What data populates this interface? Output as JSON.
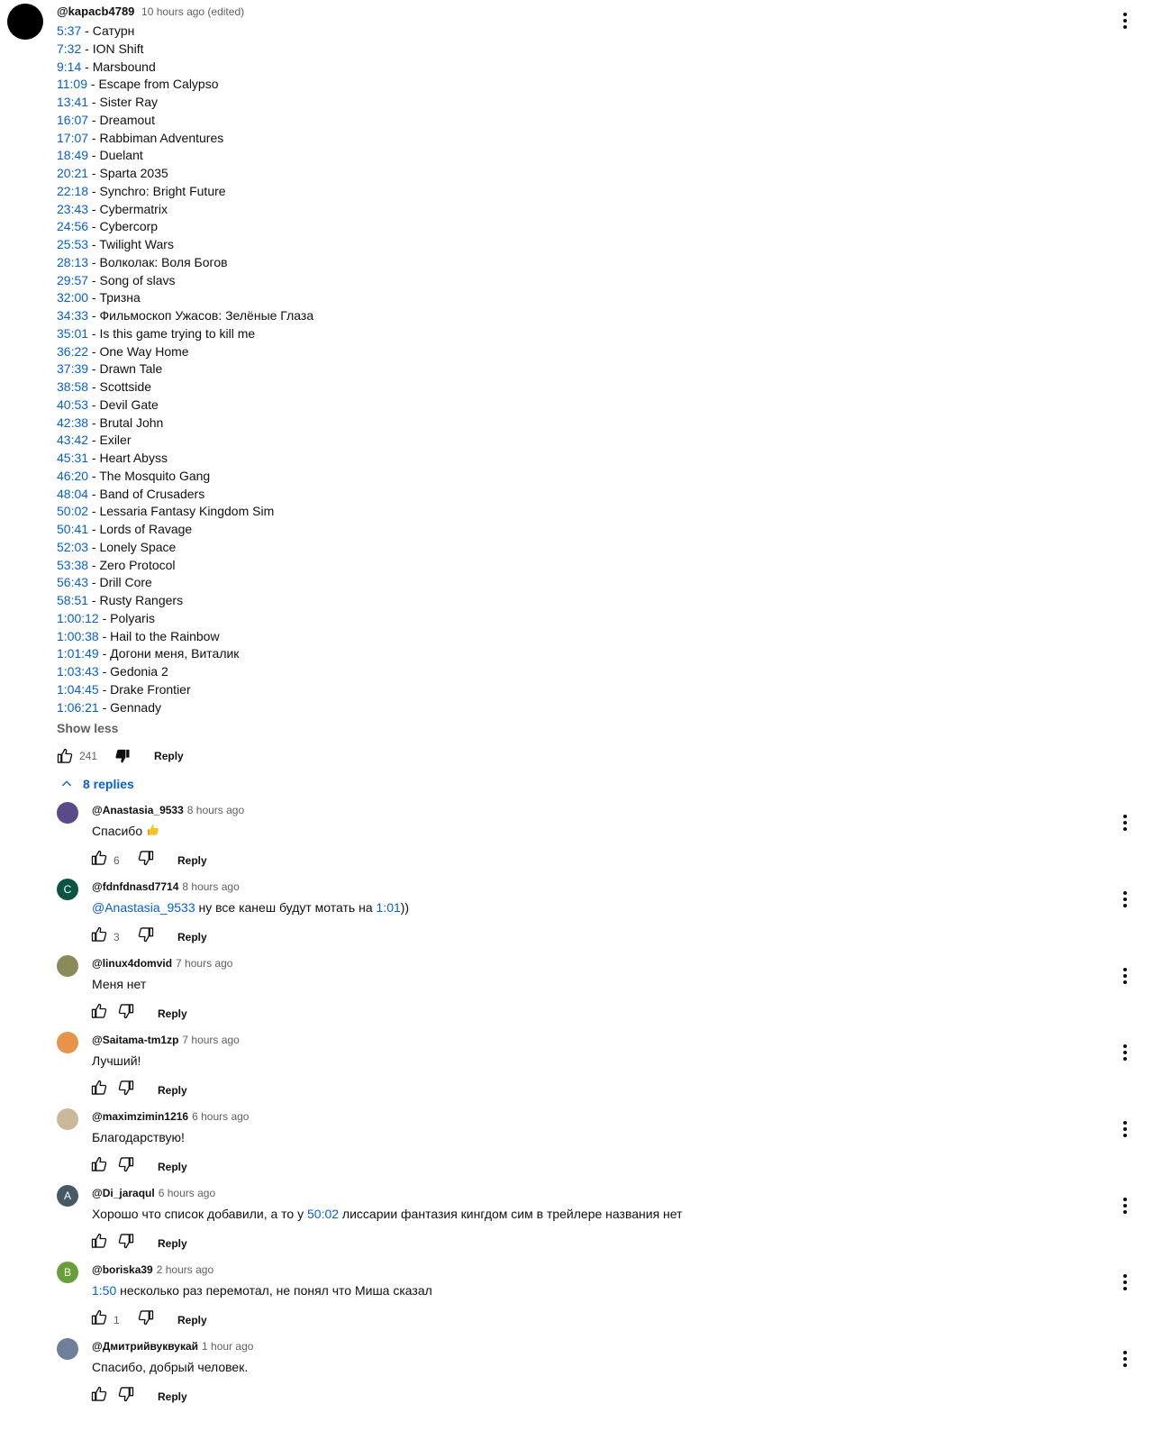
{
  "comment": {
    "handle": "@kapacb4789",
    "time": "10 hours ago (edited)",
    "chapters": [
      {
        "ts": "5:37",
        "title": " - Сатурн"
      },
      {
        "ts": "7:32",
        "title": " - ION Shift"
      },
      {
        "ts": "9:14",
        "title": " - Marsbound"
      },
      {
        "ts": "11:09",
        "title": " - Escape from Calypso"
      },
      {
        "ts": "13:41",
        "title": " - Sister Ray"
      },
      {
        "ts": "16:07",
        "title": " - Dreamout"
      },
      {
        "ts": "17:07",
        "title": " - Rabbiman Adventures"
      },
      {
        "ts": "18:49",
        "title": " - Duelant"
      },
      {
        "ts": "20:21",
        "title": " - Sparta 2035"
      },
      {
        "ts": "22:18",
        "title": " - Synchro: Bright Future"
      },
      {
        "ts": "23:43",
        "title": " - Cybermatrix"
      },
      {
        "ts": "24:56",
        "title": " - Cybercorp"
      },
      {
        "ts": "25:53",
        "title": " - Twilight Wars"
      },
      {
        "ts": "28:13",
        "title": " - Волколак: Воля Богов"
      },
      {
        "ts": "29:57",
        "title": " - Song of slavs"
      },
      {
        "ts": "32:00",
        "title": " - Тризна"
      },
      {
        "ts": "34:33",
        "title": " - Фильмоскоп Ужасов: Зелёные Глаза"
      },
      {
        "ts": "35:01",
        "title": " - Is this game trying to kill me"
      },
      {
        "ts": "36:22",
        "title": " - One Way Home"
      },
      {
        "ts": "37:39",
        "title": " - Drawn Tale"
      },
      {
        "ts": "38:58",
        "title": " - Scottside"
      },
      {
        "ts": "40:53",
        "title": " - Devil Gate"
      },
      {
        "ts": "42:38",
        "title": " - Brutal John"
      },
      {
        "ts": "43:42",
        "title": " - Exiler"
      },
      {
        "ts": "45:31",
        "title": " - Heart Abyss"
      },
      {
        "ts": "46:20",
        "title": " - The Mosquito Gang"
      },
      {
        "ts": "48:04",
        "title": " - Band of Crusaders"
      },
      {
        "ts": "50:02",
        "title": " - Lessaria Fantasy Kingdom Sim"
      },
      {
        "ts": "50:41",
        "title": " - Lords of Ravage"
      },
      {
        "ts": "52:03",
        "title": " - Lonely Space"
      },
      {
        "ts": "53:38",
        "title": " - Zero Protocol"
      },
      {
        "ts": "56:43",
        "title": " - Drill Core"
      },
      {
        "ts": "58:51",
        "title": " - Rusty Rangers"
      },
      {
        "ts": "1:00:12",
        "title": " - Polyaris"
      },
      {
        "ts": "1:00:38",
        "title": " - Hail to the Rainbow"
      },
      {
        "ts": "1:01:49",
        "title": " - Догони меня, Виталик"
      },
      {
        "ts": "1:03:43",
        "title": " - Gedonia 2"
      },
      {
        "ts": "1:04:45",
        "title": " - Drake Frontier"
      },
      {
        "ts": "1:06:21",
        "title": " - Gennady"
      }
    ],
    "show_less": "Show less",
    "likes": "241",
    "reply_label": "Reply",
    "replies_toggle": "8 replies"
  },
  "replies": [
    {
      "handle": "@Anastasia_9533",
      "time": "8 hours ago",
      "avatar_letter": "",
      "avatar_color": "#5b4a8a",
      "parts": [
        {
          "t": "Спасибо "
        }
      ],
      "emoji": "thumbs-up",
      "likes": "6"
    },
    {
      "handle": "@fdnfdnasd7714",
      "time": "8 hours ago",
      "avatar_letter": "C",
      "avatar_color": "#0b5345",
      "parts": [
        {
          "t": " "
        },
        {
          "t": "@Anastasia_9533",
          "link": true
        },
        {
          "t": " ну все канеш будут мотать на "
        },
        {
          "t": "1:01",
          "link": true
        },
        {
          "t": "))"
        }
      ],
      "likes": "3"
    },
    {
      "handle": "@linux4domvid",
      "time": "7 hours ago",
      "avatar_letter": "",
      "avatar_color": "#8a8a5a",
      "parts": [
        {
          "t": "Меня нет"
        }
      ],
      "likes": ""
    },
    {
      "handle": "@Saitama-tm1zp",
      "time": "7 hours ago",
      "avatar_letter": "",
      "avatar_color": "#e8934a",
      "parts": [
        {
          "t": "Лучший!"
        }
      ],
      "likes": ""
    },
    {
      "handle": "@maximzimin1216",
      "time": "6 hours ago",
      "avatar_letter": "",
      "avatar_color": "#c9b89a",
      "parts": [
        {
          "t": "Благодарствую!"
        }
      ],
      "likes": ""
    },
    {
      "handle": "@Di_jaraqul",
      "time": "6 hours ago",
      "avatar_letter": "A",
      "avatar_color": "#455a64",
      "parts": [
        {
          "t": "Хорошо что список добавили, а то у "
        },
        {
          "t": "50:02",
          "link": true
        },
        {
          "t": "  лиссарии фантазия кингдом сим в трейлере названия нет"
        }
      ],
      "likes": ""
    },
    {
      "handle": "@boriska39",
      "time": "2 hours ago",
      "avatar_letter": "B",
      "avatar_color": "#689f38",
      "parts": [
        {
          "t": "1:50",
          "link": true
        },
        {
          "t": " несколько раз перемотал, не понял что Миша сказал"
        }
      ],
      "likes": "1"
    },
    {
      "handle": "@Дмитрийвуквукай",
      "time": "1 hour ago",
      "avatar_letter": "",
      "avatar_color": "#6d7f99",
      "parts": [
        {
          "t": "Спасибо, добрый человек."
        }
      ],
      "likes": ""
    }
  ],
  "colors": {
    "link": "#065fd4",
    "muted": "#606060",
    "text": "#0f0f0f"
  },
  "icons": [
    "thumbs-up-icon",
    "thumbs-down-icon",
    "more-vert-icon",
    "chevron-up-icon"
  ]
}
